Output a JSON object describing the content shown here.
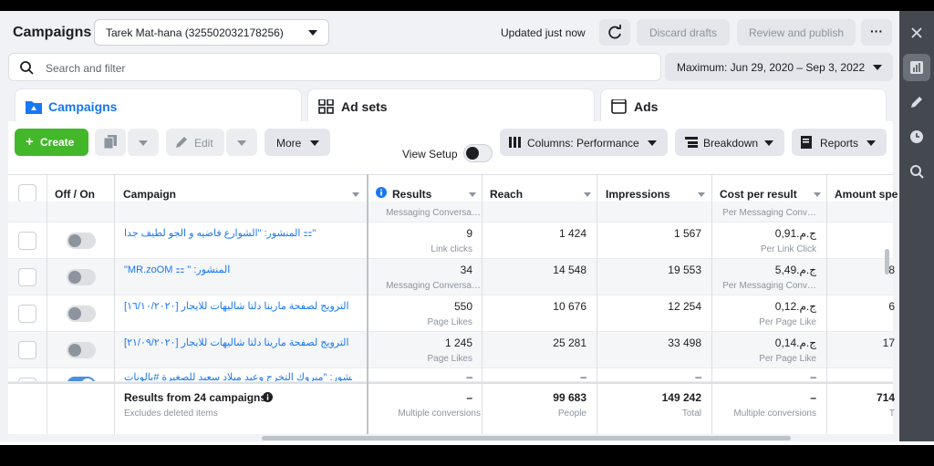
{
  "header": {
    "title": "Campaigns",
    "account": "Tarek Mat-hana (325502032178256)",
    "updated": "Updated just now",
    "discard": "Discard drafts",
    "review": "Review and publish",
    "more_dots": "···"
  },
  "search": {
    "placeholder": "Search and filter"
  },
  "daterange": "Maximum: Jun 29, 2020 – Sep 3, 2022",
  "tabs": [
    {
      "label": "Campaigns",
      "icon": "folder-icon"
    },
    {
      "label": "Ad sets",
      "icon": "grid-icon"
    },
    {
      "label": "Ads",
      "icon": "ad-icon"
    }
  ],
  "toolbar": {
    "create": "Create",
    "edit": "Edit",
    "more": "More",
    "view_setup": "View Setup",
    "columns": "Columns: Performance",
    "breakdown": "Breakdown",
    "reports": "Reports"
  },
  "columns": {
    "offon": "Off / On",
    "campaign": "Campaign",
    "results": "Results",
    "reach": "Reach",
    "impressions": "Impressions",
    "cost": "Cost per result",
    "amount": "Amount spe"
  },
  "partial_top": {
    "results_sub": "Messaging Conversa…",
    "cost_sub": "Per Messaging Conv…"
  },
  "rows": [
    {
      "name": "المنشور: \"الشوارع فاضيه و الجو لطيف جدا ⚏\"",
      "results": "9",
      "results_sub": "Link clicks",
      "reach": "1 424",
      "impressions": "1 567",
      "cost": "ج.م.0,91",
      "cost_sub": "Per Link Click",
      "amount": "",
      "on": false
    },
    {
      "name": "\"MR.zoOM ⚏ \" :المنشور",
      "results": "34",
      "results_sub": "Messaging Conversa…",
      "reach": "14 548",
      "impressions": "19 553",
      "cost": "ج.م.5,49",
      "cost_sub": "Per Messaging Conv…",
      "amount": "8",
      "on": false
    },
    {
      "name": "[١٦/١٠/٢٠٢٠] الترويج لصفحة مارينا دلتا شاليهات للايجار",
      "results": "550",
      "results_sub": "Page Likes",
      "reach": "10 676",
      "impressions": "12 254",
      "cost": "ج.م.0,12",
      "cost_sub": "Per Page Like",
      "amount": "6",
      "on": false
    },
    {
      "name": "[٢١/٠٩/٢٠٢٠] الترويج لصفحة مارينا دلتا شاليهات للايجار",
      "results": "1 245",
      "results_sub": "Page Likes",
      "reach": "25 281",
      "impressions": "33 498",
      "cost": "ج.م.0,14",
      "cost_sub": "Per Page Like",
      "amount": "17",
      "on": false
    },
    {
      "name": "المنشور: \"مبروك التخرج وعيد ميلاد سعيد للصغيرة #بالونات…\"",
      "results": "–",
      "results_sub": "",
      "reach": "–",
      "impressions": "–",
      "cost": "–",
      "cost_sub": "",
      "amount": "",
      "on": true
    }
  ],
  "totals": {
    "label": "Results from 24 campaigns",
    "sub": "Excludes deleted items",
    "results": "–",
    "results_sub": "Multiple conversions",
    "reach": "99 683",
    "reach_sub": "People",
    "impressions": "149 242",
    "impressions_sub": "Total",
    "cost": "–",
    "cost_sub": "Multiple conversions",
    "amount": "714",
    "amount_sub": "T"
  },
  "colors": {
    "accent": "#1877f2",
    "create": "#42b72a",
    "rail": "#444950"
  }
}
